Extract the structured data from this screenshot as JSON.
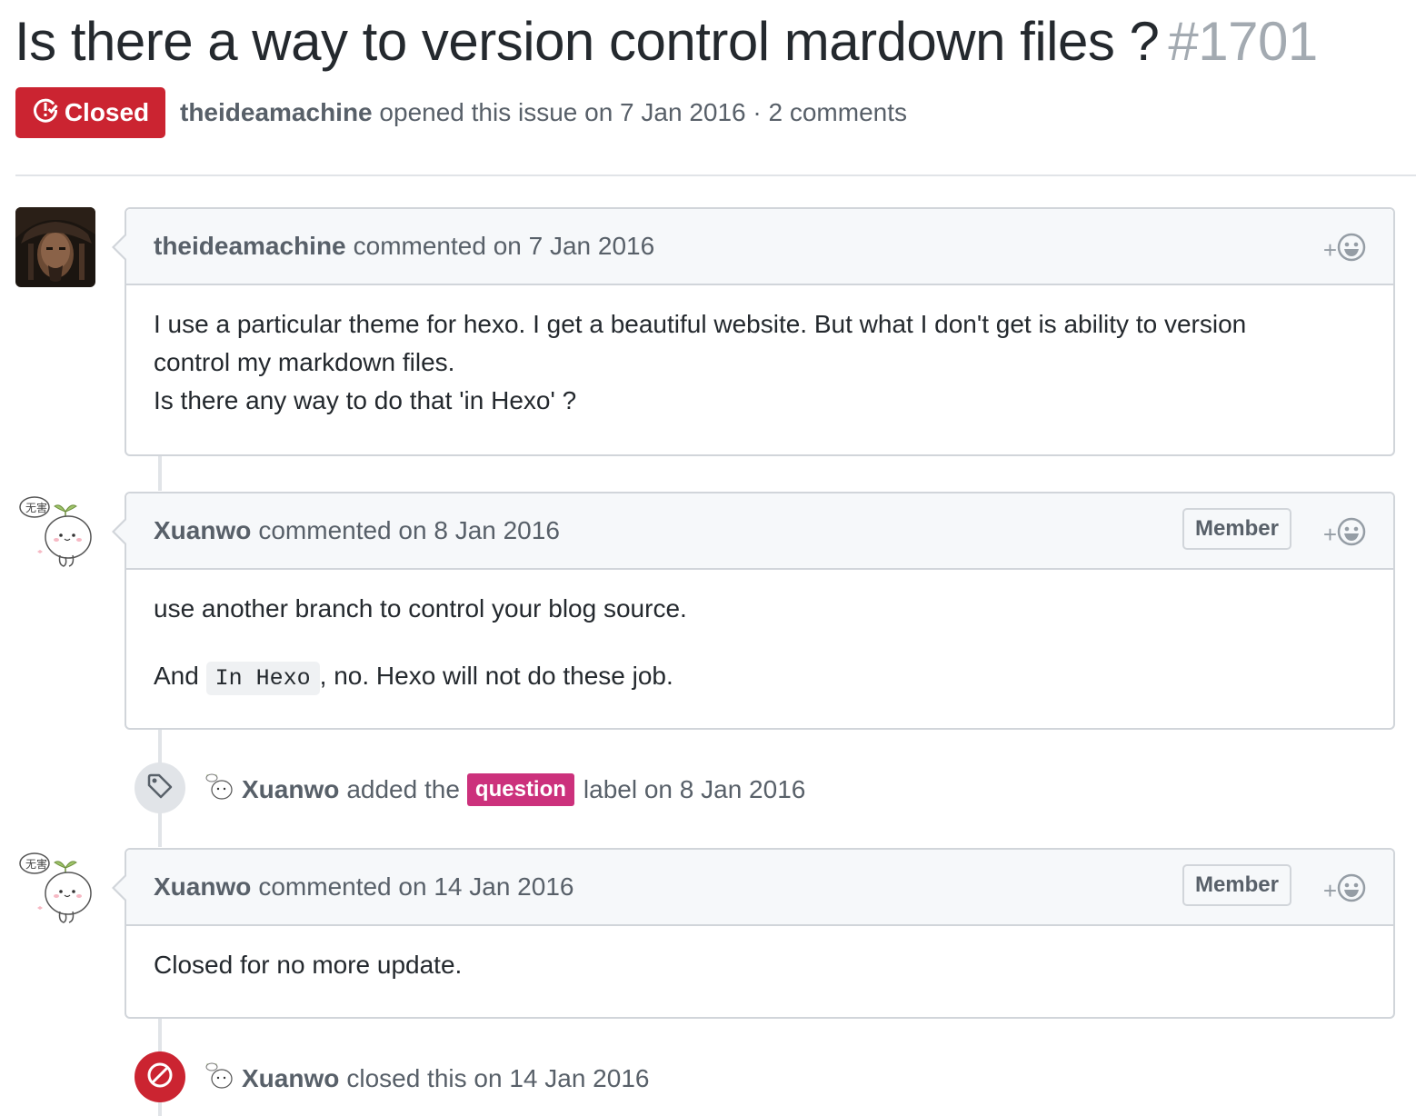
{
  "issue": {
    "title": "Is there a way to version control mardown files ?",
    "number": "#1701",
    "state": "Closed",
    "author": "theideamachine",
    "meta_text": "opened this issue on 7 Jan 2016 · 2 comments"
  },
  "comments": [
    {
      "author": "theideamachine",
      "date_text": "commented on 7 Jan 2016",
      "body": [
        "I use a particular theme for hexo. I get a beautiful website. But what I don't get is ability to version control my markdown files.",
        "Is there any way to do that 'in Hexo' ?"
      ]
    },
    {
      "author": "Xuanwo",
      "date_text": "commented on 8 Jan 2016",
      "badge": "Member",
      "body_p1": "use another branch to control your blog source.",
      "body_p2_prefix": "And",
      "body_p2_code": "In Hexo",
      "body_p2_suffix": ", no. Hexo will not do these job."
    },
    {
      "author": "Xuanwo",
      "date_text": "commented on 14 Jan 2016",
      "badge": "Member",
      "body": "Closed for no more update."
    }
  ],
  "events": [
    {
      "actor": "Xuanwo",
      "prefix": "added the",
      "label": "question",
      "suffix": "label on 8 Jan 2016",
      "icon": "tag-icon",
      "label_color": "#cc317c"
    },
    {
      "actor": "Xuanwo",
      "text": "closed this on 14 Jan 2016",
      "icon": "circle-slash-icon",
      "color": "#cb2431"
    }
  ],
  "reaction": {
    "plus": "+"
  }
}
